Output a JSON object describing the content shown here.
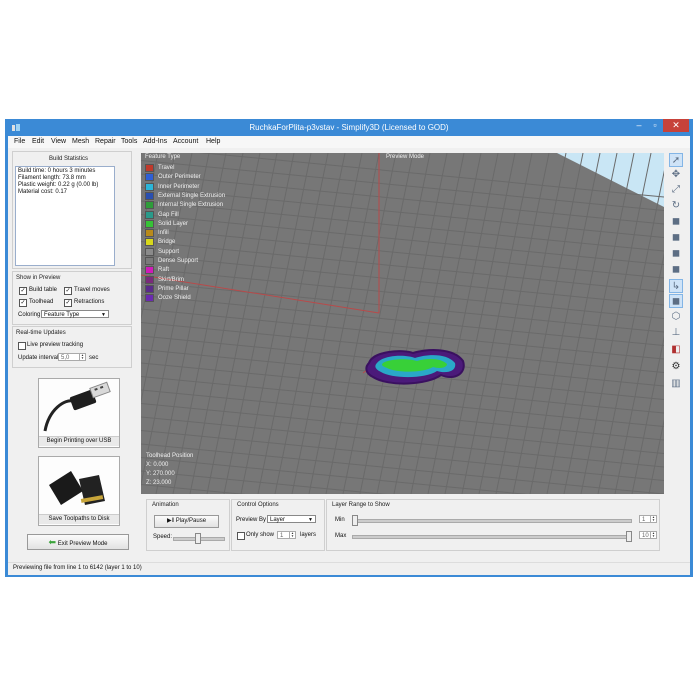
{
  "window": {
    "title": "RuchkaForPlita-p3vstav - Simplify3D (Licensed to GOD)"
  },
  "menu": [
    "File",
    "Edit",
    "View",
    "Mesh",
    "Repair",
    "Tools",
    "Add-Ins",
    "Account",
    "Help"
  ],
  "build_stats": {
    "title": "Build Statistics",
    "lines": [
      "Build time: 0 hours 3 minutes",
      "Filament length: 73.8 mm",
      "Plastic weight: 0.22 g (0.00 lb)",
      "Material cost: 0.17"
    ]
  },
  "show_in_preview": {
    "title": "Show in Preview",
    "build_table": "Build table",
    "travel_moves": "Travel moves",
    "toolhead": "Toolhead",
    "retractions": "Retractions",
    "coloring_label": "Coloring",
    "coloring_value": "Feature Type"
  },
  "realtime": {
    "title": "Real-time Updates",
    "live_tracking": "Live preview tracking",
    "interval_label": "Update interval",
    "interval_value": "5,0",
    "interval_unit": "sec"
  },
  "usb_button": "Begin Printing over USB",
  "sd_button": "Save Toolpaths to Disk",
  "exit_button": "Exit Preview Mode",
  "viewport": {
    "legend_title": "Feature Type",
    "mode_label": "Preview Mode",
    "legend": [
      {
        "label": "Travel",
        "color": "#c0392b"
      },
      {
        "label": "Outer Perimeter",
        "color": "#2f5fd6"
      },
      {
        "label": "Inner Perimeter",
        "color": "#2bb5d8"
      },
      {
        "label": "External Single Extrusion",
        "color": "#2a4fb0"
      },
      {
        "label": "Internal Single Extrusion",
        "color": "#2e9c3a"
      },
      {
        "label": "Gap Fill",
        "color": "#2a9a8a"
      },
      {
        "label": "Solid Layer",
        "color": "#36c236"
      },
      {
        "label": "Infill",
        "color": "#b88a1a"
      },
      {
        "label": "Bridge",
        "color": "#d8d81a"
      },
      {
        "label": "Support",
        "color": "#8a8a8a"
      },
      {
        "label": "Dense Support",
        "color": "#7a7a7a"
      },
      {
        "label": "Raft",
        "color": "#d01ab8"
      },
      {
        "label": "Skirt/Brim",
        "color": "#7a2a7a"
      },
      {
        "label": "Prime Pillar",
        "color": "#5a2a8a"
      },
      {
        "label": "Ooze Shield",
        "color": "#6a2ab0"
      }
    ],
    "toolhead_title": "Toolhead Position",
    "toolhead_x": "X: 0.000",
    "toolhead_y": "Y: 270.000",
    "toolhead_z": "Z: 23.000"
  },
  "animation": {
    "title": "Animation",
    "play_pause": "Play/Pause",
    "speed_label": "Speed:"
  },
  "control": {
    "title": "Control Options",
    "preview_by_label": "Preview By",
    "preview_by_value": "Layer",
    "only_show": "Only show",
    "only_show_value": "1",
    "layers": "layers"
  },
  "layer_range": {
    "title": "Layer Range to Show",
    "min_label": "Min",
    "min_value": "1",
    "max_label": "Max",
    "max_value": "10"
  },
  "status_text": "Previewing file from line 1 to 6142 (layer 1 to 10)",
  "toolbar_icons": [
    "select-icon",
    "move-icon",
    "scale-icon",
    "rotate-icon",
    "view-cube-icon",
    "view-front-icon",
    "view-side-icon",
    "view-top-icon",
    "axes-icon",
    "view-iso-icon",
    "cube-outline-icon",
    "axis-z-icon",
    "cross-section-icon",
    "settings-gear-icon",
    "ruler-icon"
  ]
}
